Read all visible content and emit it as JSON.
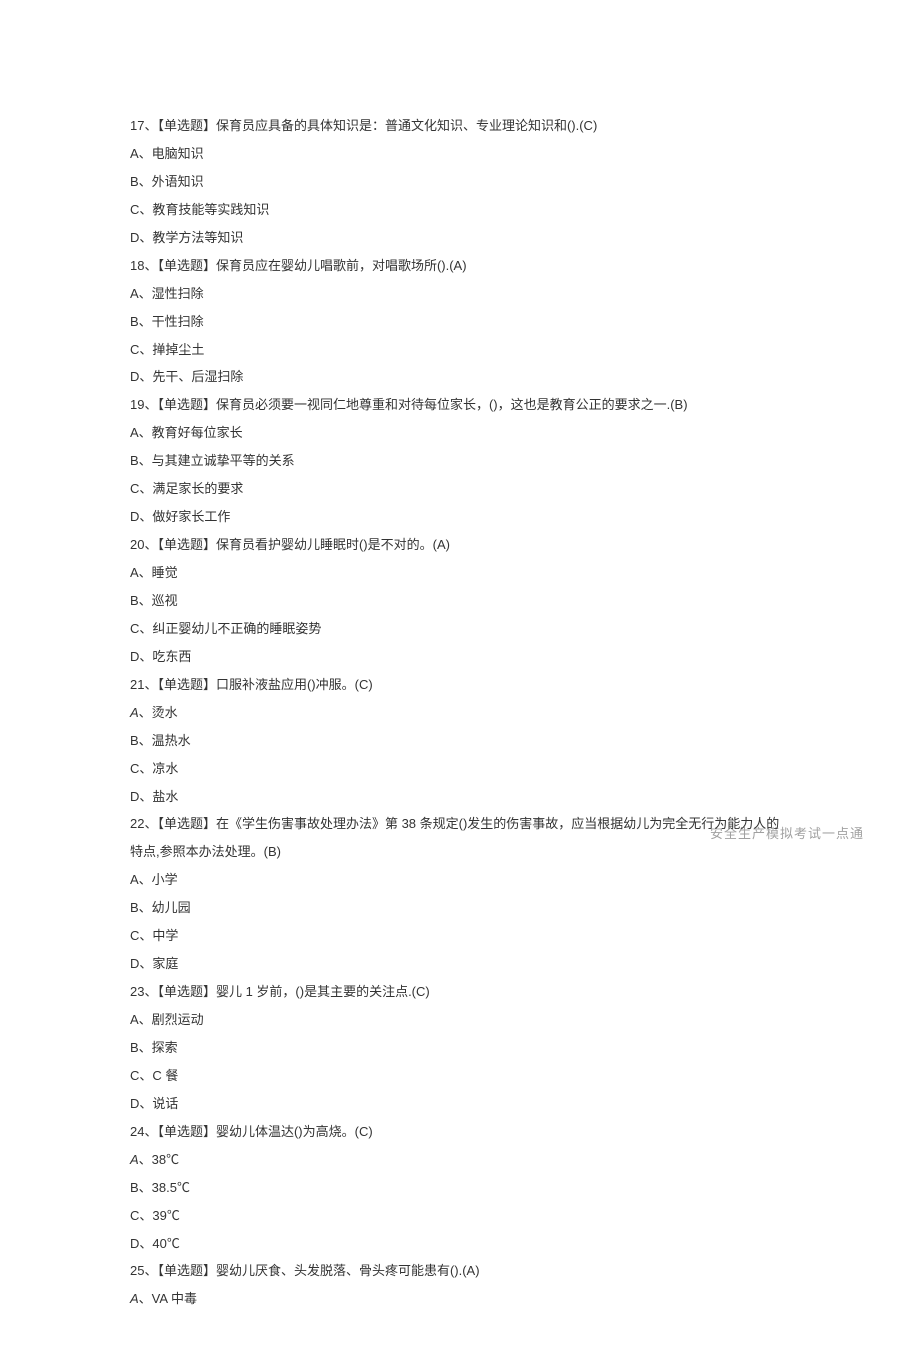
{
  "stamp": "安全生产模拟考试一点通",
  "items": [
    {
      "type": "q",
      "text": "17、【单选题】保育员应具备的具体知识是：普通文化知识、专业理论知识和().(C)"
    },
    {
      "type": "o",
      "text": "A、电脑知识"
    },
    {
      "type": "o",
      "text": "B、外语知识"
    },
    {
      "type": "o",
      "text": "C、教育技能等实践知识"
    },
    {
      "type": "o",
      "text": "D、教学方法等知识"
    },
    {
      "type": "q",
      "text": "18、【单选题】保育员应在婴幼儿唱歌前，对唱歌场所().(A)"
    },
    {
      "type": "o",
      "text": "A、湿性扫除"
    },
    {
      "type": "o",
      "text": "B、干性扫除"
    },
    {
      "type": "o",
      "text": "C、掸掉尘土"
    },
    {
      "type": "o",
      "text": "D、先干、后湿扫除"
    },
    {
      "type": "q",
      "text": "19、【单选题】保育员必须要一视同仁地尊重和对待每位家长，()，这也是教育公正的要求之一.(B)"
    },
    {
      "type": "o",
      "text": "A、教育好每位家长"
    },
    {
      "type": "o",
      "text": "B、与其建立诚挚平等的关系"
    },
    {
      "type": "o",
      "text": "C、满足家长的要求"
    },
    {
      "type": "o",
      "text": "D、做好家长工作"
    },
    {
      "type": "q",
      "text": "20、【单选题】保育员看护婴幼儿睡眠时()是不对的。(A)"
    },
    {
      "type": "o",
      "text": "A、睡觉"
    },
    {
      "type": "o",
      "text": "B、巡视"
    },
    {
      "type": "o",
      "text": "C、纠正婴幼儿不正确的睡眠姿势"
    },
    {
      "type": "o",
      "text": "D、吃东西"
    },
    {
      "type": "q",
      "text": "21、【单选题】口服补液盐应用()冲服。(C)"
    },
    {
      "type": "oi",
      "text": "A、烫水"
    },
    {
      "type": "o",
      "text": "B、温热水"
    },
    {
      "type": "o",
      "text": "C、凉水"
    },
    {
      "type": "o",
      "text": "D、盐水"
    },
    {
      "type": "q",
      "text": "22、【单选题】在《学生伤害事故处理办法》第 38 条规定()发生的伤害事故，应当根据幼儿为完全无行为能力人的特点,参照本办法处理。(B)"
    },
    {
      "type": "o",
      "text": "A、小学"
    },
    {
      "type": "o",
      "text": "B、幼儿园"
    },
    {
      "type": "o",
      "text": "C、中学"
    },
    {
      "type": "o",
      "text": "D、家庭"
    },
    {
      "type": "q",
      "text": "23、【单选题】婴儿 1 岁前，()是其主要的关注点.(C)"
    },
    {
      "type": "o",
      "text": "A、剧烈运动"
    },
    {
      "type": "o",
      "text": "B、探索"
    },
    {
      "type": "o",
      "text": "C、C 餐"
    },
    {
      "type": "o",
      "text": "D、说话"
    },
    {
      "type": "q",
      "text": "24、【单选题】婴幼儿体温达()为高烧。(C)"
    },
    {
      "type": "oi",
      "text": "A、38℃"
    },
    {
      "type": "o",
      "text": "B、38.5℃"
    },
    {
      "type": "o",
      "text": "C、39℃"
    },
    {
      "type": "o",
      "text": "D、40℃"
    },
    {
      "type": "q",
      "text": "25、【单选题】婴幼儿厌食、头发脱落、骨头疼可能患有().(A)"
    },
    {
      "type": "oi",
      "text": "A、VA 中毒"
    }
  ]
}
